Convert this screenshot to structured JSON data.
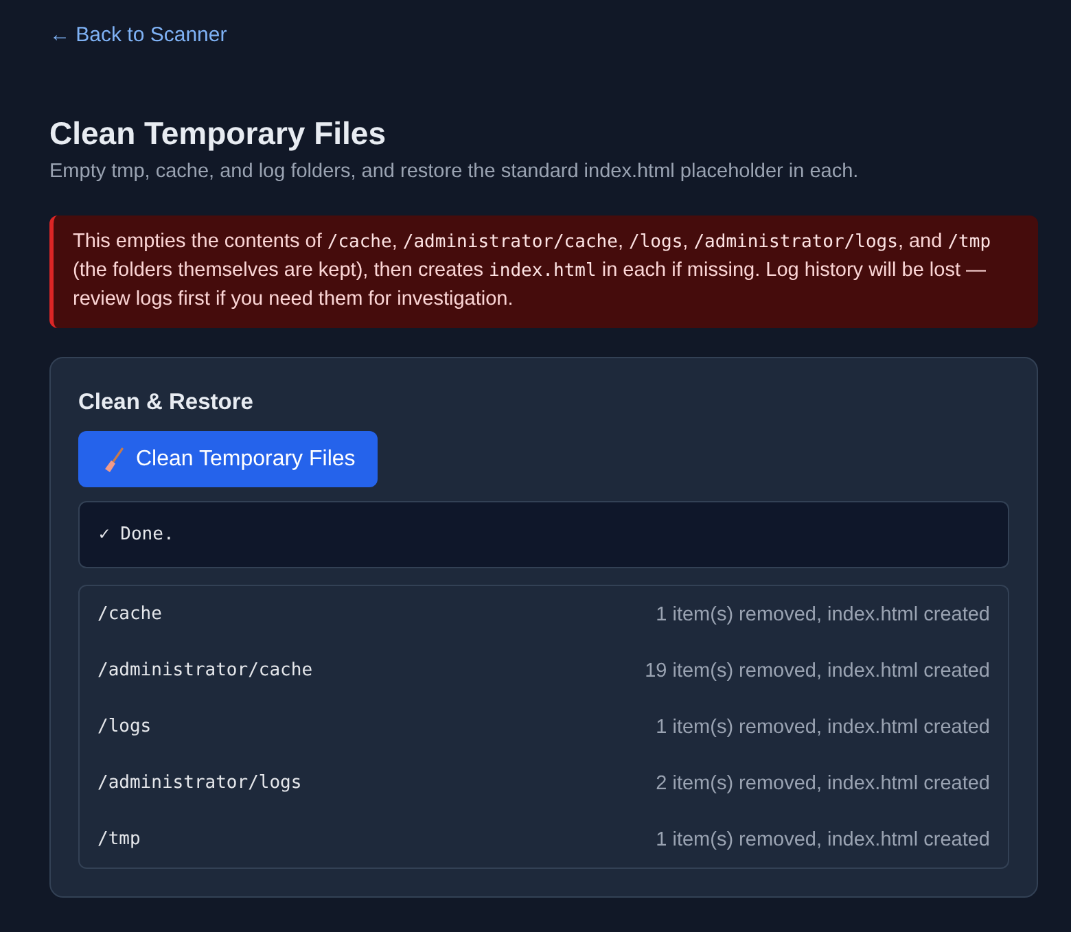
{
  "back_link": {
    "label": "← Back to Scanner"
  },
  "header": {
    "title": "Clean Temporary Files",
    "subtitle": "Empty tmp, cache, and log folders, and restore the standard index.html placeholder in each."
  },
  "warning": {
    "segments": [
      {
        "kind": "text",
        "text": "This empties the contents of "
      },
      {
        "kind": "code",
        "text": "/cache"
      },
      {
        "kind": "text",
        "text": ", "
      },
      {
        "kind": "code",
        "text": "/administrator/cache"
      },
      {
        "kind": "text",
        "text": ", "
      },
      {
        "kind": "code",
        "text": "/logs"
      },
      {
        "kind": "text",
        "text": ", "
      },
      {
        "kind": "code",
        "text": "/administrator/logs"
      },
      {
        "kind": "text",
        "text": ", and "
      },
      {
        "kind": "code",
        "text": "/tmp"
      },
      {
        "kind": "text",
        "text": " (the folders themselves are kept), then creates "
      },
      {
        "kind": "code",
        "text": "index.html"
      },
      {
        "kind": "text",
        "text": " in each if missing. Log history will be lost — review logs first if you need them for investigation."
      }
    ]
  },
  "card": {
    "title": "Clean & Restore",
    "button": {
      "label": "Clean Temporary Files"
    },
    "status": {
      "text": "✓ Done."
    },
    "results": [
      {
        "path": "/cache",
        "result": "1 item(s) removed, index.html created"
      },
      {
        "path": "/administrator/cache",
        "result": "19 item(s) removed, index.html created"
      },
      {
        "path": "/logs",
        "result": "1 item(s) removed, index.html created"
      },
      {
        "path": "/administrator/logs",
        "result": "2 item(s) removed, index.html created"
      },
      {
        "path": "/tmp",
        "result": "1 item(s) removed, index.html created"
      }
    ]
  }
}
